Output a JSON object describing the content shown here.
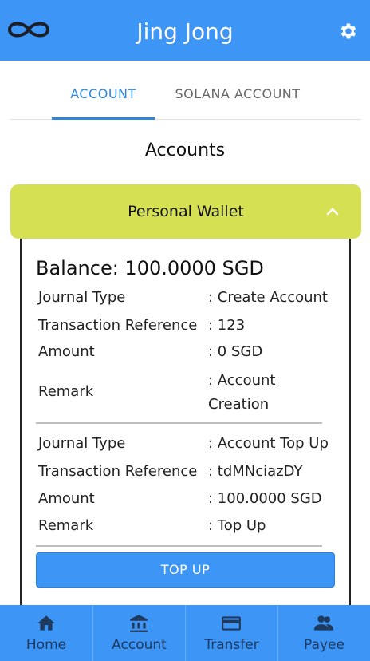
{
  "header": {
    "title": "Jing Jong",
    "logo_icon": "infinity-icon",
    "settings_icon": "gear-icon"
  },
  "tabs": [
    {
      "label": "ACCOUNT",
      "active": true
    },
    {
      "label": "SOLANA ACCOUNT",
      "active": false
    }
  ],
  "section_title": "Accounts",
  "wallet": {
    "name": "Personal Wallet",
    "expanded": true,
    "balance": "Balance: 100.0000 SGD",
    "transactions": [
      {
        "journal_type_label": "Journal Type",
        "journal_type": ": Create Account",
        "reference_label": "Transaction Reference",
        "reference": ": 123",
        "amount_label": "Amount",
        "amount": ": 0 SGD",
        "remark_label": "Remark",
        "remark": ": Account Creation"
      },
      {
        "journal_type_label": "Journal Type",
        "journal_type": ": Account Top Up",
        "reference_label": "Transaction Reference",
        "reference": ": tdMNciazDY",
        "amount_label": "Amount",
        "amount": ": 100.0000 SGD",
        "remark_label": "Remark",
        "remark": ": Top Up"
      }
    ],
    "topup_label": "TOP UP"
  },
  "bottom_nav": [
    {
      "label": "Home",
      "icon": "home-icon",
      "active": false
    },
    {
      "label": "Account",
      "icon": "bank-icon",
      "active": true
    },
    {
      "label": "Transfer",
      "icon": "credit-card-icon",
      "active": false
    },
    {
      "label": "Payee",
      "icon": "people-icon",
      "active": false
    }
  ],
  "colors": {
    "primary": "#3d95f5",
    "accent_tab": "#2f86d9",
    "wallet_header": "#d5e053",
    "nav_text": "#1f3a5f"
  }
}
